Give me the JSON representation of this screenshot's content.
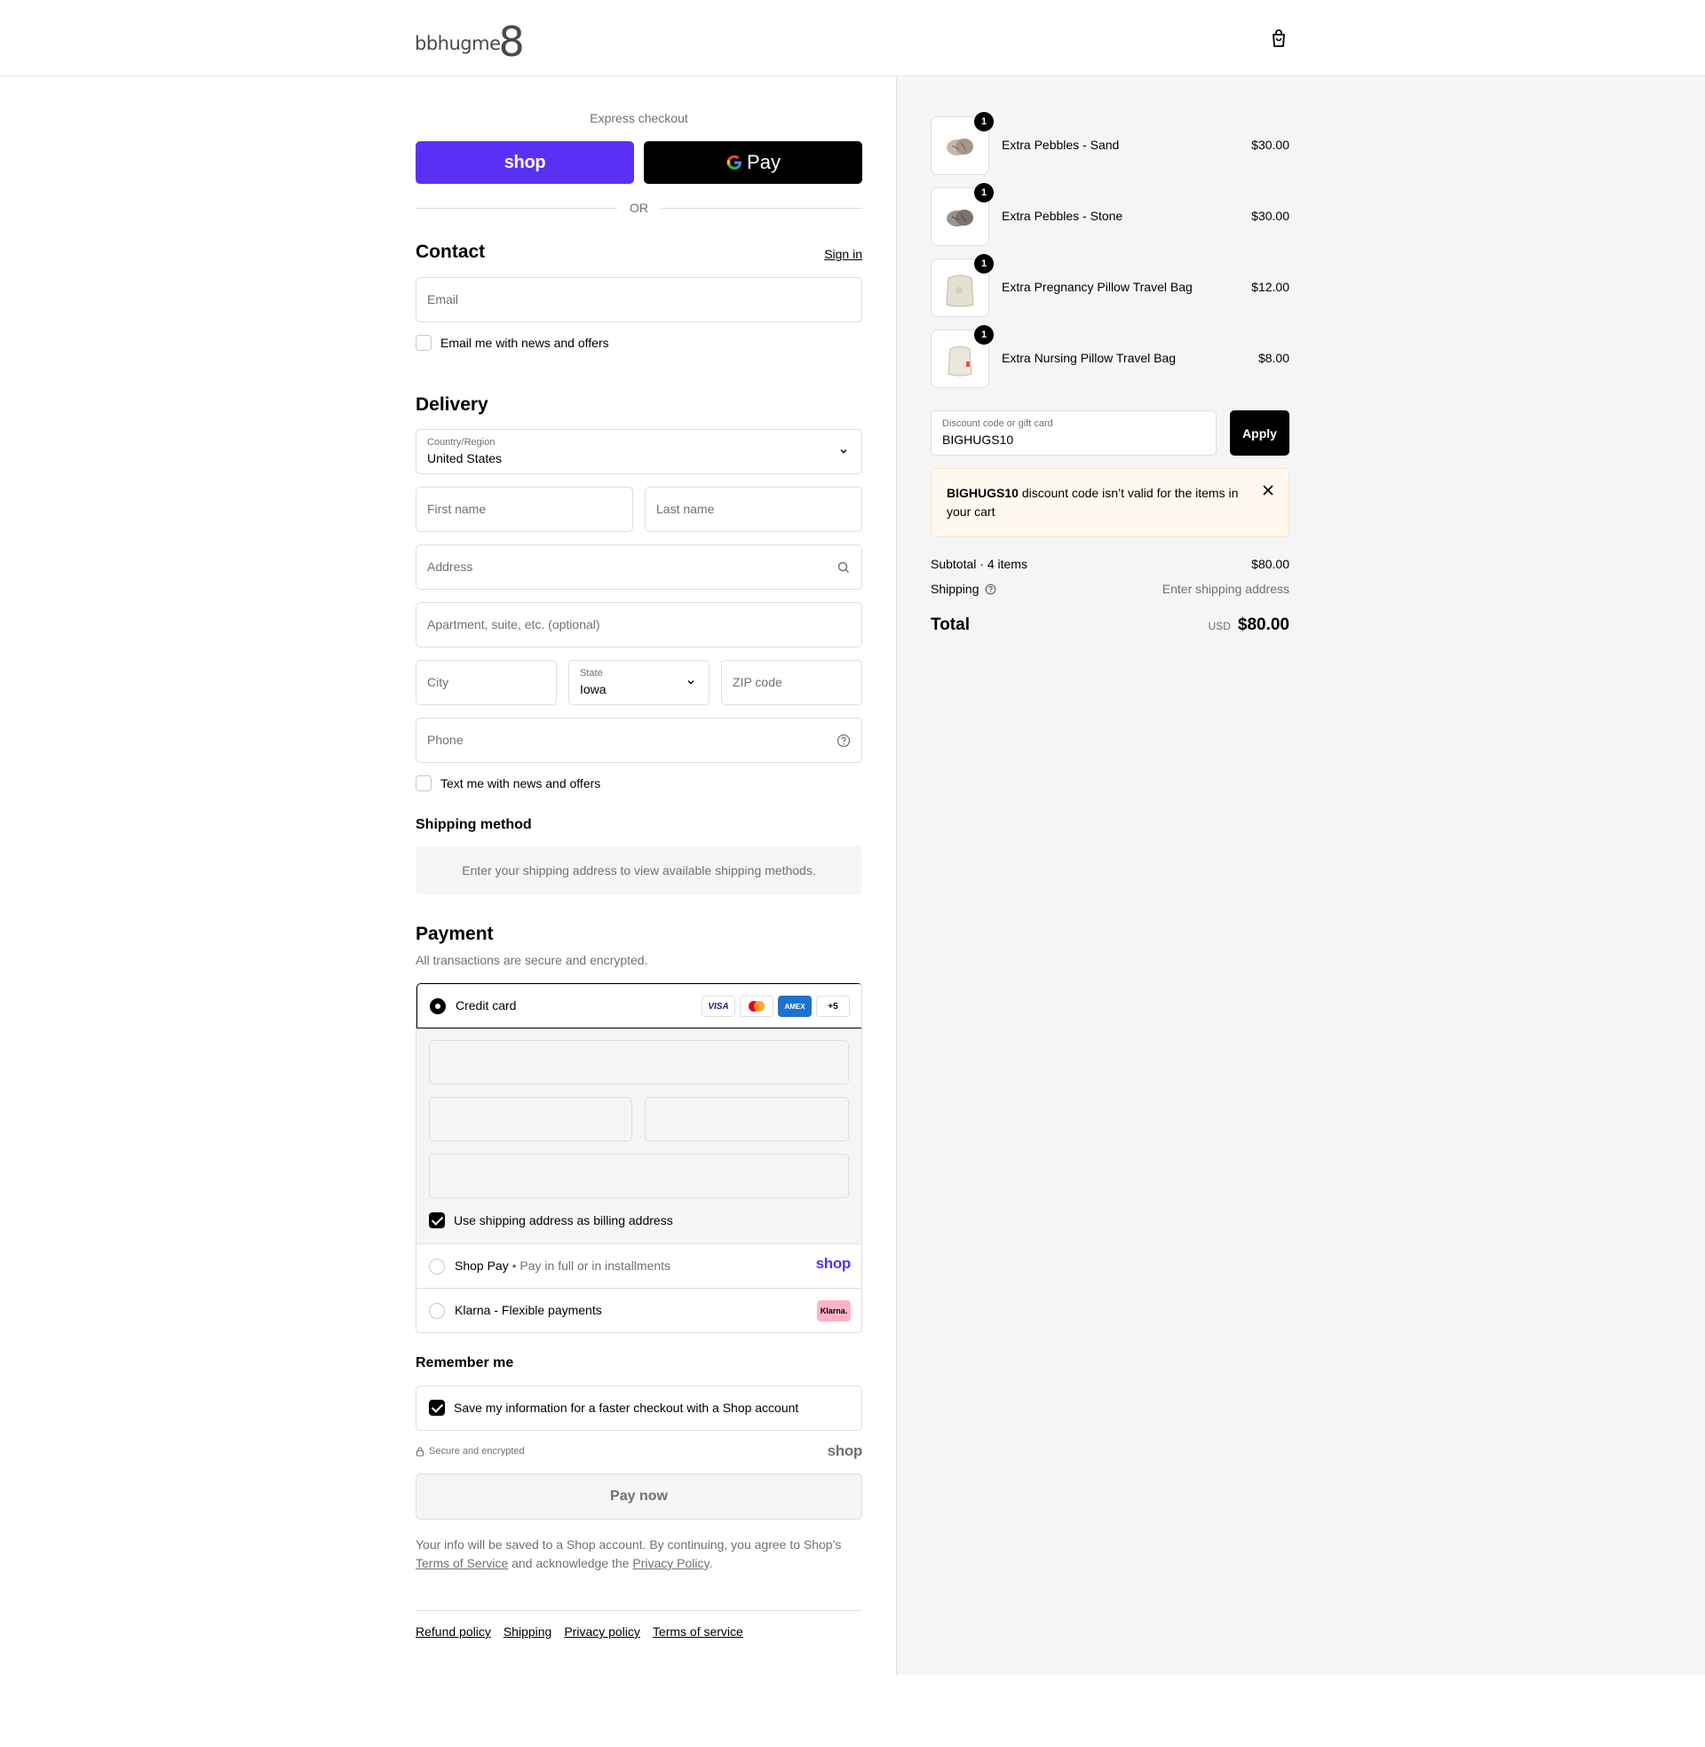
{
  "brand": {
    "logo_text": "bbhugme"
  },
  "express": {
    "title": "Express checkout",
    "shop_label": "shop",
    "gpay_label": "Pay",
    "or_label": "OR"
  },
  "contact": {
    "title": "Contact",
    "sign_in": "Sign in",
    "email_placeholder": "Email",
    "news_checkbox": "Email me with news and offers"
  },
  "delivery": {
    "title": "Delivery",
    "country_label": "Country/Region",
    "country_value": "United States",
    "first_name_placeholder": "First name",
    "last_name_placeholder": "Last name",
    "address_placeholder": "Address",
    "apartment_placeholder": "Apartment, suite, etc. (optional)",
    "city_placeholder": "City",
    "state_label": "State",
    "state_value": "Iowa",
    "zip_placeholder": "ZIP code",
    "phone_placeholder": "Phone",
    "text_checkbox": "Text me with news and offers"
  },
  "shipping_method": {
    "title": "Shipping method",
    "note": "Enter your shipping address to view available shipping methods."
  },
  "payment": {
    "title": "Payment",
    "subtitle": "All transactions are secure and encrypted.",
    "credit_card_label": "Credit card",
    "card_logos": [
      "VISA",
      "MC",
      "AMEX",
      "+5"
    ],
    "billing_checkbox": "Use shipping address as billing address",
    "shop_pay_label": "Shop Pay",
    "shop_pay_sub": "Pay in full or in installments",
    "shop_pay_logo": "shop",
    "klarna_label": "Klarna - Flexible payments",
    "klarna_logo": "Klarna."
  },
  "remember": {
    "title": "Remember me",
    "save_checkbox": "Save my information for a faster checkout with a Shop account",
    "secure_text": "Secure and encrypted",
    "shop_logo": "shop"
  },
  "pay_now": "Pay now",
  "legal": {
    "text1": "Your info will be saved to a Shop account. By continuing, you agree to Shop’s",
    "tos": "Terms of Service",
    "text2": "and acknowledge the",
    "privacy": "Privacy Policy",
    "text3": "."
  },
  "footer": {
    "links": [
      "Refund policy",
      "Shipping",
      "Privacy policy",
      "Terms of service"
    ]
  },
  "cart": {
    "items": [
      {
        "name": "Extra Pebbles - Sand",
        "price": "$30.00",
        "qty": "1"
      },
      {
        "name": "Extra Pebbles - Stone",
        "price": "$30.00",
        "qty": "1"
      },
      {
        "name": "Extra Pregnancy Pillow Travel Bag",
        "price": "$12.00",
        "qty": "1"
      },
      {
        "name": "Extra Nursing Pillow Travel Bag",
        "price": "$8.00",
        "qty": "1"
      }
    ],
    "discount_label": "Discount code or gift card",
    "discount_value": "BIGHUGS10",
    "apply_label": "Apply",
    "error_code": "BIGHUGS10",
    "error_text": "discount code isn’t valid for the items in your cart",
    "subtotal_label": "Subtotal · 4 items",
    "subtotal_value": "$80.00",
    "shipping_label": "Shipping",
    "shipping_value": "Enter shipping address",
    "total_label": "Total",
    "currency": "USD",
    "total_value": "$80.00"
  },
  "colors": {
    "shop_purple": "#5a31f4",
    "error_bg": "#fff8ef",
    "summary_bg": "#f5f5f5"
  }
}
